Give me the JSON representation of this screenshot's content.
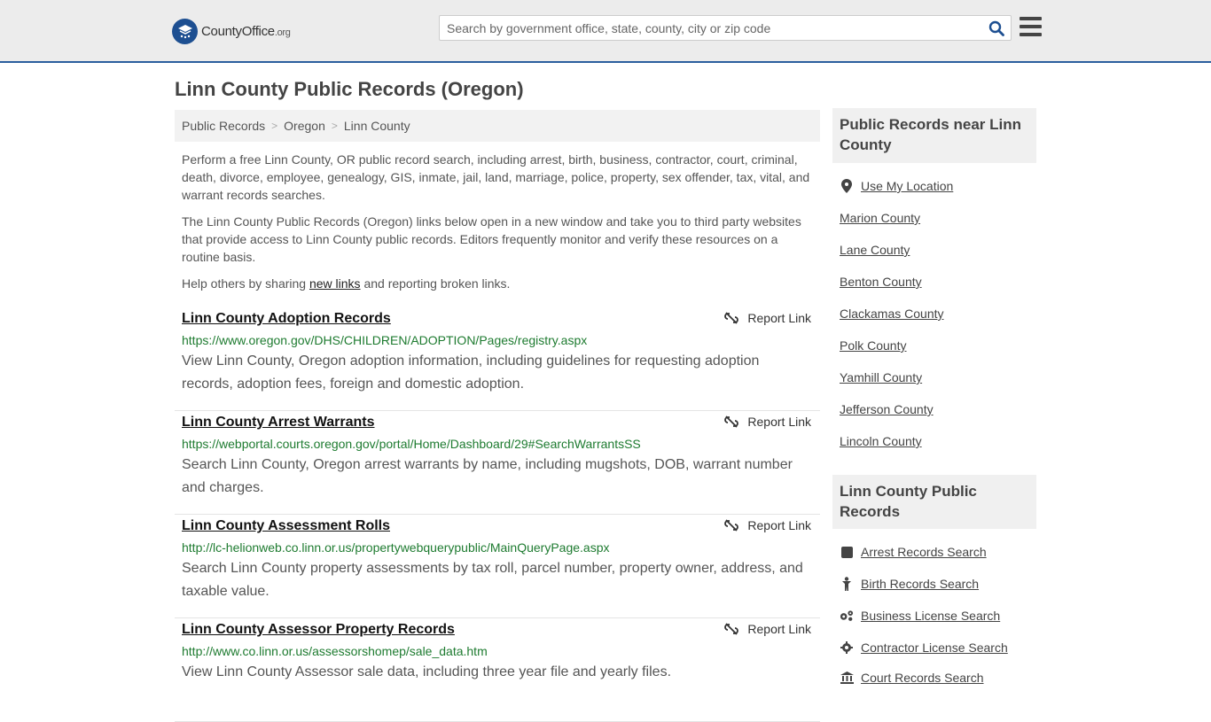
{
  "header": {
    "logo_text": "CountyOffice",
    "logo_tld": ".org",
    "search_placeholder": "Search by government office, state, county, city or zip code",
    "brand_color": "#1d4f91"
  },
  "page": {
    "title": "Linn County Public Records (Oregon)"
  },
  "breadcrumb": [
    "Public Records",
    "Oregon",
    "Linn County"
  ],
  "intro": {
    "para1": "Perform a free Linn County, OR public record search, including arrest, birth, business, contractor, court, criminal, death, divorce, employee, genealogy, GIS, inmate, jail, land, marriage, police, property, sex offender, tax, vital, and warrant records searches.",
    "para2": "The Linn County Public Records (Oregon) links below open in a new window and take you to third party websites that provide access to Linn County public records. Editors frequently monitor and verify these resources on a routine basis.",
    "para3_before": "Help others by sharing ",
    "para3_link": "new links",
    "para3_after": " and reporting broken links."
  },
  "records": [
    {
      "title": "Linn County Adoption Records",
      "report_label": "Report Link",
      "url": "https://www.oregon.gov/DHS/CHILDREN/ADOPTION/Pages/registry.aspx",
      "description": "View Linn County, Oregon adoption information, including guidelines for requesting adoption records, adoption fees, foreign and domestic adoption."
    },
    {
      "title": "Linn County Arrest Warrants",
      "report_label": "Report Link",
      "url": "https://webportal.courts.oregon.gov/portal/Home/Dashboard/29#SearchWarrantsSS",
      "description": "Search Linn County, Oregon arrest warrants by name, including mugshots, DOB, warrant number and charges."
    },
    {
      "title": "Linn County Assessment Rolls",
      "report_label": "Report Link",
      "url": "http://lc-helionweb.co.linn.or.us/propertywebquerypublic/MainQueryPage.aspx",
      "description": "Search Linn County property assessments by tax roll, parcel number, property owner, address, and taxable value."
    },
    {
      "title": "Linn County Assessor Property Records",
      "report_label": "Report Link",
      "url": "http://www.co.linn.or.us/assessorshomep/sale_data.htm",
      "description": "View Linn County Assessor sale data, including three year file and yearly files."
    }
  ],
  "sidebar": {
    "nearby_title": "Public Records near Linn County",
    "use_location": "Use My Location",
    "nearby": [
      "Marion County",
      "Lane County",
      "Benton County",
      "Clackamas County",
      "Polk County",
      "Yamhill County",
      "Jefferson County",
      "Lincoln County"
    ],
    "records_title": "Linn County Public Records",
    "records_links": [
      {
        "label": "Arrest Records Search",
        "icon": "arrest-icon"
      },
      {
        "label": "Birth Records Search",
        "icon": "birth-icon"
      },
      {
        "label": "Business License Search",
        "icon": "business-icon"
      },
      {
        "label": "Contractor License Search",
        "icon": "contractor-icon"
      },
      {
        "label": "Court Records Search",
        "icon": "court-icon"
      }
    ]
  }
}
